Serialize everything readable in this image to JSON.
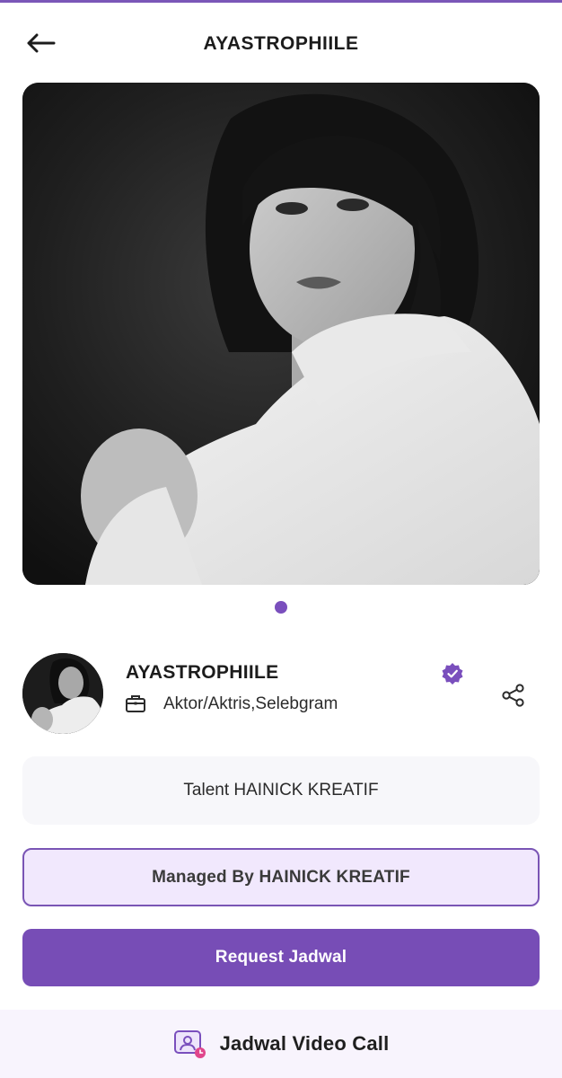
{
  "header": {
    "title": "AYASTROPHIILE",
    "back_icon": "arrow-left-icon"
  },
  "carousel": {
    "image_count": 1,
    "active_index": 0,
    "accent_color": "#7a4fbd"
  },
  "profile": {
    "name": "AYASTROPHIILE",
    "verified": true,
    "profession": "Aktor/Aktris,Selebgram",
    "profession_icon": "briefcase-icon",
    "share_icon": "share-icon"
  },
  "talent_info": {
    "text": "Talent HAINICK KREATIF"
  },
  "buttons": {
    "managed_by": "Managed By HAINICK KREATIF",
    "request": "Request Jadwal"
  },
  "bottom_bar": {
    "label": "Jadwal Video Call",
    "icon": "video-call-icon"
  },
  "colors": {
    "primary": "#774db6",
    "primary_light": "#f1e8fd",
    "card_bg": "#f7f7fa"
  }
}
